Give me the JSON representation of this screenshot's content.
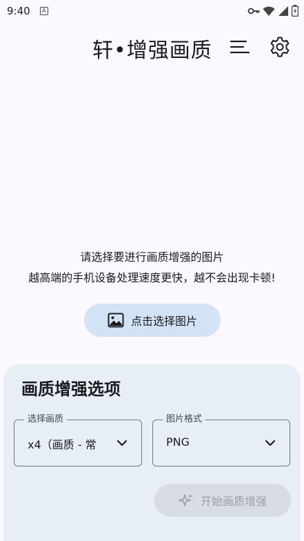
{
  "status_bar": {
    "time": "9:40",
    "notification_icon": "A"
  },
  "app_bar": {
    "title": "轩•增强画质",
    "menu_icon": "menu-icon",
    "settings_icon": "gear-icon"
  },
  "main": {
    "hint_line1": "请选择要进行画质增强的图片",
    "hint_line2": "越高端的手机设备处理速度更快，越不会出现卡顿!",
    "pick_button_label": "点击选择图片"
  },
  "options": {
    "title": "画质增强选项",
    "quality_label": "选择画质",
    "quality_value": "x4（画质 - 常",
    "format_label": "图片格式",
    "format_value": "PNG",
    "start_button_label": "开始画质增强"
  },
  "colors": {
    "background": "#fbf9fe",
    "primary_container": "#d3e3f5",
    "card": "#e7eef6",
    "disabled_button": "#d8dde3"
  }
}
